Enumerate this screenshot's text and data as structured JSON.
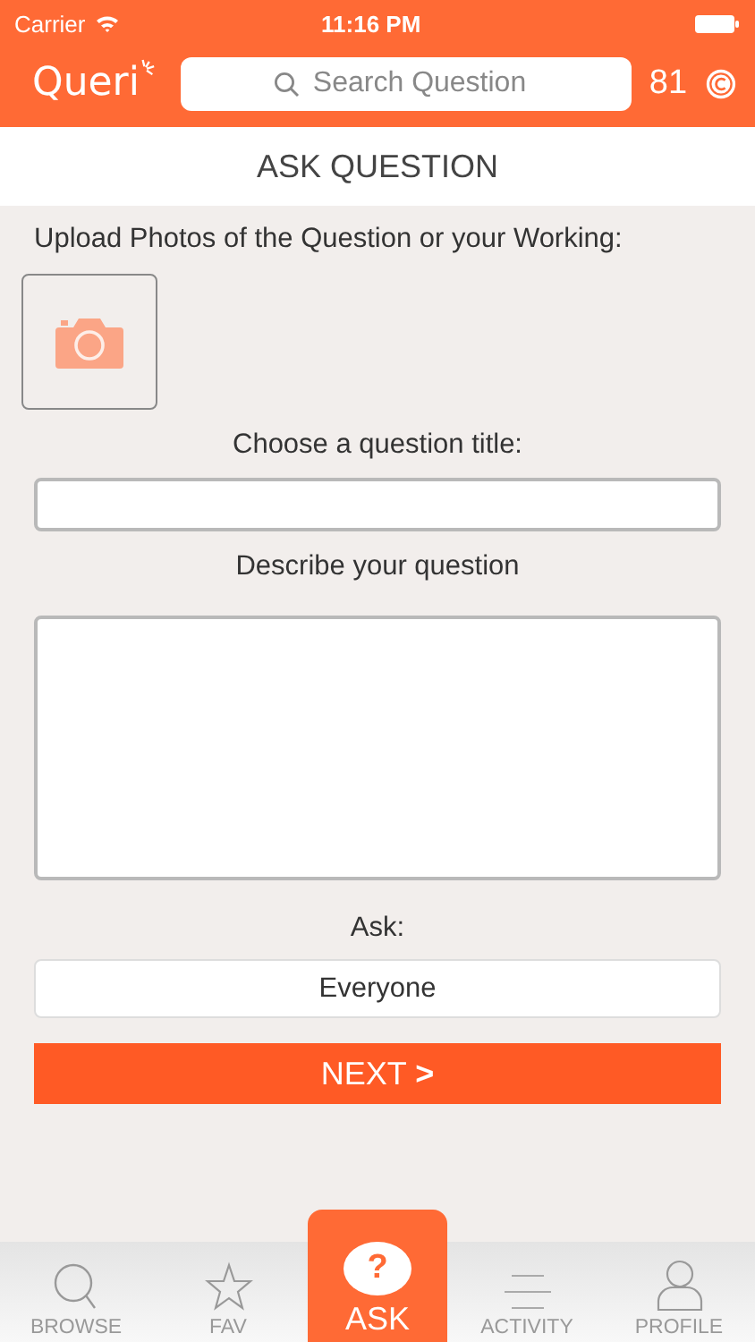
{
  "status_bar": {
    "carrier": "Carrier",
    "time": "11:16 PM"
  },
  "nav": {
    "logo": "Queri",
    "search": {
      "placeholder": "Search Question"
    },
    "credits": "81"
  },
  "header": {
    "title": "ASK QUESTION"
  },
  "form": {
    "upload_label": "Upload Photos of the Question or your Working:",
    "title_label": "Choose a question title:",
    "description_label": "Describe your question",
    "ask_label": "Ask:",
    "audience": "Everyone",
    "next_button": "NEXT",
    "next_arrow": ">"
  },
  "tabs": [
    {
      "label": "BROWSE",
      "kind": "search",
      "selected": false
    },
    {
      "label": "FAV",
      "kind": "star",
      "selected": false
    },
    {
      "label": "ASK",
      "kind": "bubble",
      "glyph": "?",
      "selected": true
    },
    {
      "label": "ACTIVITY",
      "kind": "lines",
      "selected": false
    },
    {
      "label": "PROFILE",
      "kind": "person",
      "selected": false
    }
  ]
}
